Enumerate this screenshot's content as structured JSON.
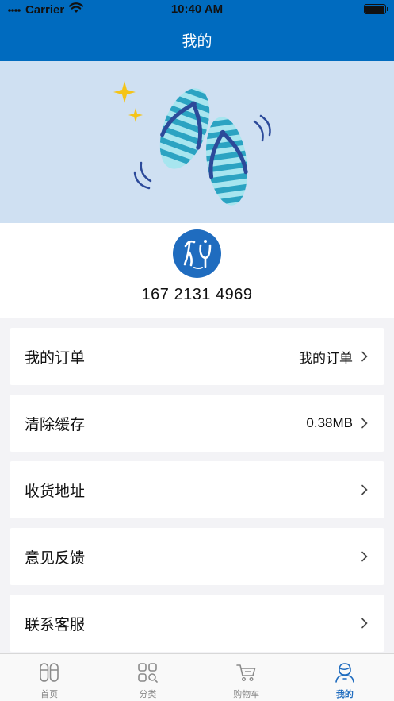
{
  "status_bar": {
    "carrier": "Carrier",
    "time": "10:40 AM"
  },
  "header": {
    "title": "我的"
  },
  "profile": {
    "phone": "167 2131 4969"
  },
  "menu": [
    {
      "label": "我的订单",
      "value": "我的订单"
    },
    {
      "label": "清除缓存",
      "value": "0.38MB"
    },
    {
      "label": "收货地址",
      "value": ""
    },
    {
      "label": "意见反馈",
      "value": ""
    },
    {
      "label": "联系客服",
      "value": ""
    }
  ],
  "tabs": [
    {
      "label": "首页",
      "icon": "slippers-icon",
      "active": false
    },
    {
      "label": "分类",
      "icon": "category-grid-icon",
      "active": false
    },
    {
      "label": "购物车",
      "icon": "cart-icon",
      "active": false
    },
    {
      "label": "我的",
      "icon": "person-icon",
      "active": true
    }
  ],
  "colors": {
    "brand": "#006bbf",
    "accent": "#1f6cbf",
    "banner_bg": "#cfe0f2",
    "page_bg": "#f3f3f6"
  }
}
